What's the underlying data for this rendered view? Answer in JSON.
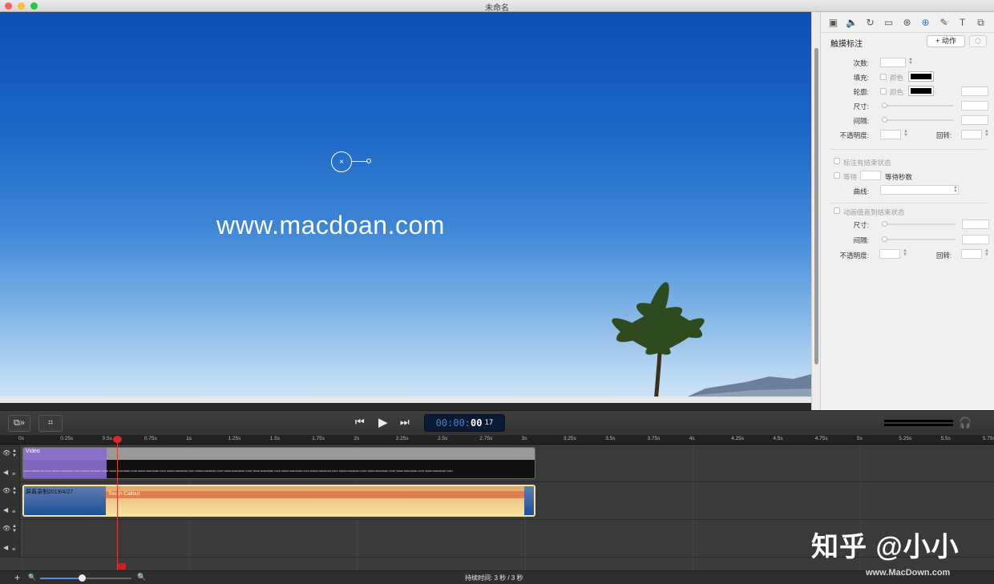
{
  "window": {
    "title": "未命名",
    "lights": {
      "close": "#fe5f57",
      "minimize": "#febc2e",
      "zoom": "#28c840"
    }
  },
  "canvas": {
    "watermark_text": "www.macdoan.com",
    "callout_symbol": "×"
  },
  "panel": {
    "toolbar_icons": [
      "video-icon",
      "audio-icon",
      "cursor-icon",
      "screen-icon",
      "clip-icon",
      "touch-icon",
      "annotation-icon",
      "text-icon",
      "actions-icon"
    ],
    "title": "触摸标注",
    "add_action_label": "+ 动作",
    "rows": {
      "count_label": "次数:",
      "fill_label": "填充:",
      "fill_color_label": "颜色",
      "outline_label": "轮廓:",
      "outline_color_label": "颜色",
      "size_label": "尺寸:",
      "spacing_label": "间隔:",
      "opacity_label": "不透明度:",
      "rotation_label": "回转:"
    },
    "end_state": {
      "label": "标注有结束状态",
      "wait_label": "等待",
      "wait_seconds_label": "等待秒数",
      "curve_label": "曲线:"
    },
    "animate": {
      "label": "动画值直到结束状态",
      "size_label": "尺寸:",
      "spacing_label": "间隔:",
      "opacity_label": "不透明度:",
      "rotation_label": "回转:"
    }
  },
  "transport": {
    "rewind_icon": "⏮",
    "play_icon": "▶",
    "forward_icon": "⏭",
    "timecode_main": "00:00:",
    "timecode_seconds": "00",
    "timecode_frame": "17"
  },
  "timeline": {
    "ticks": [
      "0s",
      "0.25s",
      "0.5s",
      "0.75s",
      "1s",
      "1.25s",
      "1.5s",
      "1.75s",
      "2s",
      "2.25s",
      "2.5s",
      "2.75s",
      "3s",
      "3.25s",
      "3.5s",
      "3.75s",
      "4s",
      "4.25s",
      "4.5s",
      "4.75s",
      "5s",
      "5.25s",
      "5.5s",
      "5.75s"
    ],
    "video_clip_label": "Video",
    "video_stripe_text": "www.macdoan.com www.macdoan.com www.macdoan.com www.macdoan.com www.macdoan.com www.macdoan.com www.macdoan.com www.macdoan.com www.macdoan.com www.macdoan.com www.macdoan.com www.macdoan.com www.macdoan.com www.macdoan.com www.macdoan.com",
    "recording_clip_label": "屏幕录制2019/4/27",
    "touch_callout_label": "Touch Callout",
    "playhead_time_seconds": 0.57
  },
  "status": {
    "duration_label": "持续时间: 3 秒  /  3 秒",
    "zoom_level": 0.46
  },
  "overlay": {
    "zhihu": "知乎 @小小",
    "macdown": "www.MacDown.com"
  }
}
